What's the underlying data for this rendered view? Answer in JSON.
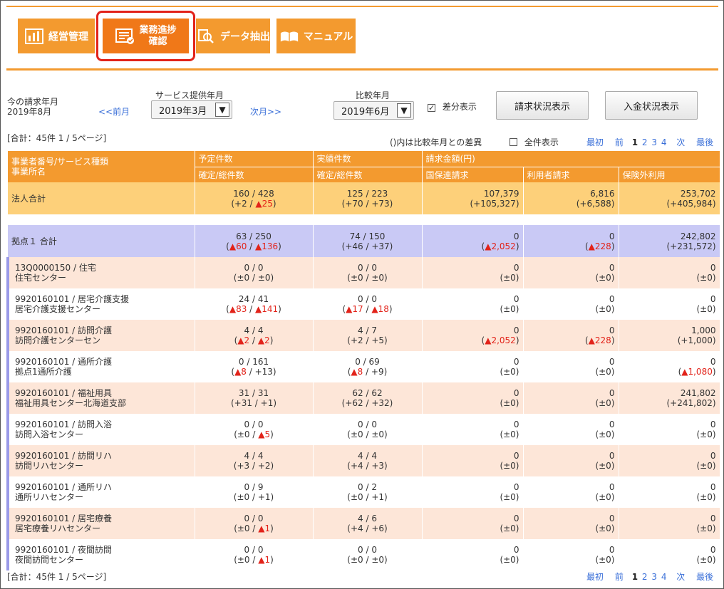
{
  "nav": [
    {
      "label": "経営管理",
      "icon": "bar-chart-icon"
    },
    {
      "label1": "業務進捗",
      "label2": "確認",
      "icon": "checklist-icon"
    },
    {
      "label": "データ抽出",
      "icon": "search-icon"
    },
    {
      "label": "マニュアル",
      "icon": "book-icon"
    }
  ],
  "controls": {
    "current_label": "今の請求年月",
    "current_value": "2019年8月",
    "prev_link": "<<前月",
    "service_label": "サービス提供年月",
    "service_value": "2019年3月",
    "next_link": "次月>>",
    "compare_label": "比較年月",
    "compare_value": "2019年6月",
    "diff_label": "差分表示",
    "billing_button": "請求状況表示",
    "payment_button": "入金状況表示"
  },
  "summary": "[合計：45件  1 / 5ページ]",
  "note": "()内は比較年月との差異",
  "show_all_label": "全件表示",
  "pager": {
    "first": "最初",
    "prev": "前",
    "pages": [
      "1",
      "2",
      "3",
      "4"
    ],
    "current": "1",
    "next": "次",
    "last": "最後"
  },
  "headers": {
    "col1a": "事業者番号/サービス種類",
    "col1b": "事業所名",
    "planned": "予定件数",
    "actual": "実績件数",
    "amount": "請求金額(円)",
    "confirmed_total": "確定/総件数",
    "national": "国保連請求",
    "user": "利用者請求",
    "outside": "保険外利用"
  },
  "corp_total": {
    "name": "法人合計",
    "planned": "160 / 428",
    "planned_diff": [
      "(+2 / ",
      "▲25",
      ")"
    ],
    "actual": "125 / 223",
    "actual_diff": "(+70 / +73)",
    "national": "107,379",
    "national_diff": "(+105,327)",
    "user": "6,816",
    "user_diff": "(+6,588)",
    "outside": "253,702",
    "outside_diff": "(+405,984)"
  },
  "base_total": {
    "name": "拠点１ 合計",
    "planned": "63 / 250",
    "planned_diff": [
      "(",
      "▲60",
      " / ",
      "▲136",
      ")"
    ],
    "actual": "74 / 150",
    "actual_diff": "(+46 / +37)",
    "national": "0",
    "national_diff": [
      "(",
      "▲2,052",
      ")"
    ],
    "user": "0",
    "user_diff": [
      "(",
      "▲228",
      ")"
    ],
    "outside": "242,802",
    "outside_diff": "(+231,572)"
  },
  "rows": [
    {
      "code": "13Q0000150 / 住宅",
      "name": "住宅センター",
      "planned": "0 / 0",
      "planned_diff": "(±0 / ±0)",
      "actual": "0 / 0",
      "actual_diff": "(±0 / ±0)",
      "national": "0",
      "national_diff": "(±0)",
      "user": "0",
      "user_diff": "(±0)",
      "outside": "0",
      "outside_diff": "(±0)"
    },
    {
      "code": "9920160101 / 居宅介護支援",
      "name": "居宅介護支援センター",
      "planned": "24 / 41",
      "planned_diff": "(▲83 / ▲141)",
      "actual": "0 / 0",
      "actual_diff": "(▲17 / ▲18)",
      "national": "0",
      "national_diff": "(±0)",
      "user": "0",
      "user_diff": "(±0)",
      "outside": "0",
      "outside_diff": "(±0)"
    },
    {
      "code": "9920160101 / 訪問介護",
      "name": "訪問介護センターセン",
      "planned": "4 / 4",
      "planned_diff": "(▲2 / ▲2)",
      "actual": "4 / 7",
      "actual_diff": "(+2 / +5)",
      "national": "0",
      "national_diff": "(▲2,052)",
      "user": "0",
      "user_diff": "(▲228)",
      "outside": "1,000",
      "outside_diff": "(+1,000)"
    },
    {
      "code": "9920160101 / 通所介護",
      "name": "拠点1通所介護",
      "planned": "0 / 161",
      "planned_diff": "(▲8 / +13)",
      "actual": "0 / 69",
      "actual_diff": "(▲8 / +9)",
      "national": "0",
      "national_diff": "(±0)",
      "user": "0",
      "user_diff": "(±0)",
      "outside": "0",
      "outside_diff": "(▲1,080)"
    },
    {
      "code": "9920160101 / 福祉用具",
      "name": "福祉用具センター北海道支部",
      "planned": "31 / 31",
      "planned_diff": "(+31 / +1)",
      "actual": "62 / 62",
      "actual_diff": "(+62 / +32)",
      "national": "0",
      "national_diff": "(±0)",
      "user": "0",
      "user_diff": "(±0)",
      "outside": "241,802",
      "outside_diff": "(+241,802)"
    },
    {
      "code": "9920160101 / 訪問入浴",
      "name": "訪問入浴センター",
      "planned": "0 / 0",
      "planned_diff": "(±0 / ▲5)",
      "actual": "0 / 0",
      "actual_diff": "(±0 / ±0)",
      "national": "0",
      "national_diff": "(±0)",
      "user": "0",
      "user_diff": "(±0)",
      "outside": "0",
      "outside_diff": "(±0)"
    },
    {
      "code": "9920160101 / 訪問リハ",
      "name": "訪問リハセンター",
      "planned": "4 / 4",
      "planned_diff": "(+3 / +2)",
      "actual": "4 / 4",
      "actual_diff": "(+4 / +3)",
      "national": "0",
      "national_diff": "(±0)",
      "user": "0",
      "user_diff": "(±0)",
      "outside": "0",
      "outside_diff": "(±0)"
    },
    {
      "code": "9920160101 / 通所リハ",
      "name": "通所リハセンター",
      "planned": "0 / 9",
      "planned_diff": "(±0 / +1)",
      "actual": "0 / 2",
      "actual_diff": "(±0 / +1)",
      "national": "0",
      "national_diff": "(±0)",
      "user": "0",
      "user_diff": "(±0)",
      "outside": "0",
      "outside_diff": "(±0)"
    },
    {
      "code": "9920160101 / 居宅療養",
      "name": "居宅療養リハセンター",
      "planned": "0 / 0",
      "planned_diff": "(±0 / ▲1)",
      "actual": "4 / 6",
      "actual_diff": "(+4 / +6)",
      "national": "0",
      "national_diff": "(±0)",
      "user": "0",
      "user_diff": "(±0)",
      "outside": "0",
      "outside_diff": "(±0)"
    },
    {
      "code": "9920160101 / 夜間訪問",
      "name": "夜間訪問センター",
      "planned": "0 / 0",
      "planned_diff": "(±0 / ▲1)",
      "actual": "0 / 0",
      "actual_diff": "(±0 / ±0)",
      "national": "0",
      "national_diff": "(±0)",
      "user": "0",
      "user_diff": "(±0)",
      "outside": "0",
      "outside_diff": "(±0)"
    }
  ],
  "colors": {
    "accent": "#f39a2f",
    "active": "#f07818",
    "highlight": "#e2231a",
    "base_row": "#c9c9f5",
    "total_row": "#fdd07a",
    "odd_row": "#fde6d8"
  }
}
